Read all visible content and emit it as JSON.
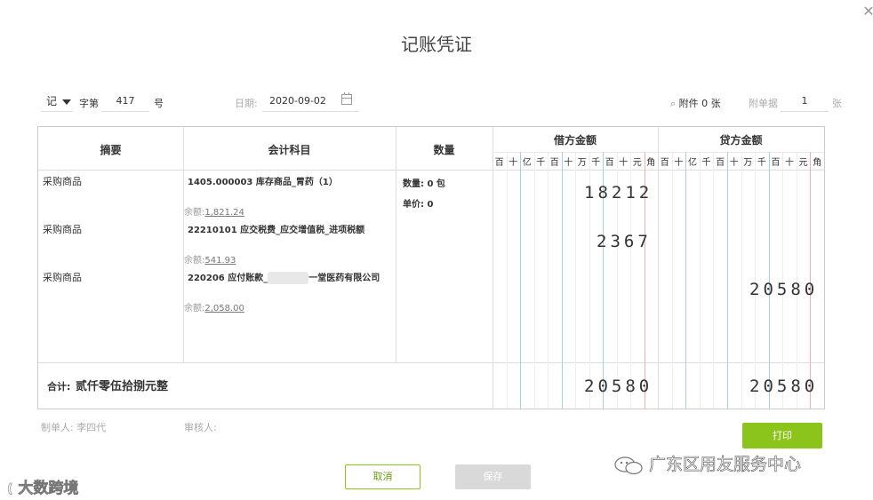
{
  "dialog": {
    "title": "记账凭证",
    "close_icon": "close-icon"
  },
  "voucher": {
    "type": "记",
    "zi_label": "字第",
    "number": "417",
    "hao_label": "号",
    "date_label": "日期:",
    "date_value": "2020-09-02",
    "attachment_text": "附件 0 张",
    "attach_doc_label": "附单据",
    "attach_doc_count": "1",
    "zhang_label": "张"
  },
  "table": {
    "headers": {
      "summary": "摘要",
      "account": "会计科目",
      "quantity": "数量",
      "debit": "借方金额",
      "credit": "贷方金额"
    },
    "digit_units": [
      "百",
      "十",
      "亿",
      "千",
      "百",
      "十",
      "万",
      "千",
      "百",
      "十",
      "元",
      "角"
    ],
    "quantity_info": {
      "qty_label": "数量:",
      "qty_value": "0 包",
      "price_label": "单价:",
      "price_value": "0"
    },
    "rows": [
      {
        "summary": "采购商品",
        "account": "1405.000003 库存商品_胃药（1）",
        "balance_label": "余额:",
        "balance": "1,821.24",
        "debit": "18212",
        "credit": ""
      },
      {
        "summary": "采购商品",
        "account": "22210101 应交税费_应交增值税_进项税额",
        "balance_label": "余额:",
        "balance": "541.93",
        "debit": "2367",
        "credit": ""
      },
      {
        "summary": "采购商品",
        "account_prefix": "220206 应付账款_",
        "account_suffix": "一堂医药有限公司",
        "balance_label": "余额:",
        "balance": "2,058.00",
        "debit": "",
        "credit": "20580"
      }
    ],
    "total": {
      "label": "合计:",
      "amount_words": "贰仟零伍拾捌元整",
      "debit": "20580",
      "credit": "20580"
    }
  },
  "footer": {
    "maker_label": "制单人: 李四代",
    "auditor_label": "审核人:",
    "print_label": "打印",
    "cancel_label": "取消",
    "save_label": "保存"
  },
  "watermarks": {
    "right": "广东区用友服务中心",
    "left": "大数跨境"
  },
  "colors": {
    "accent": "#8bc41a",
    "grid_line": "#dddddd",
    "digit_yuan_line": "#f0b0b0",
    "digit_wan_line": "#a8cfe8"
  }
}
